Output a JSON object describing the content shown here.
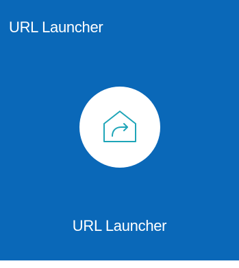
{
  "tile": {
    "title": "URL Launcher",
    "label": "URL Launcher",
    "icon": "house-share-arrow-icon",
    "background_color": "#0a68b8",
    "icon_color": "#1ea5b8"
  }
}
